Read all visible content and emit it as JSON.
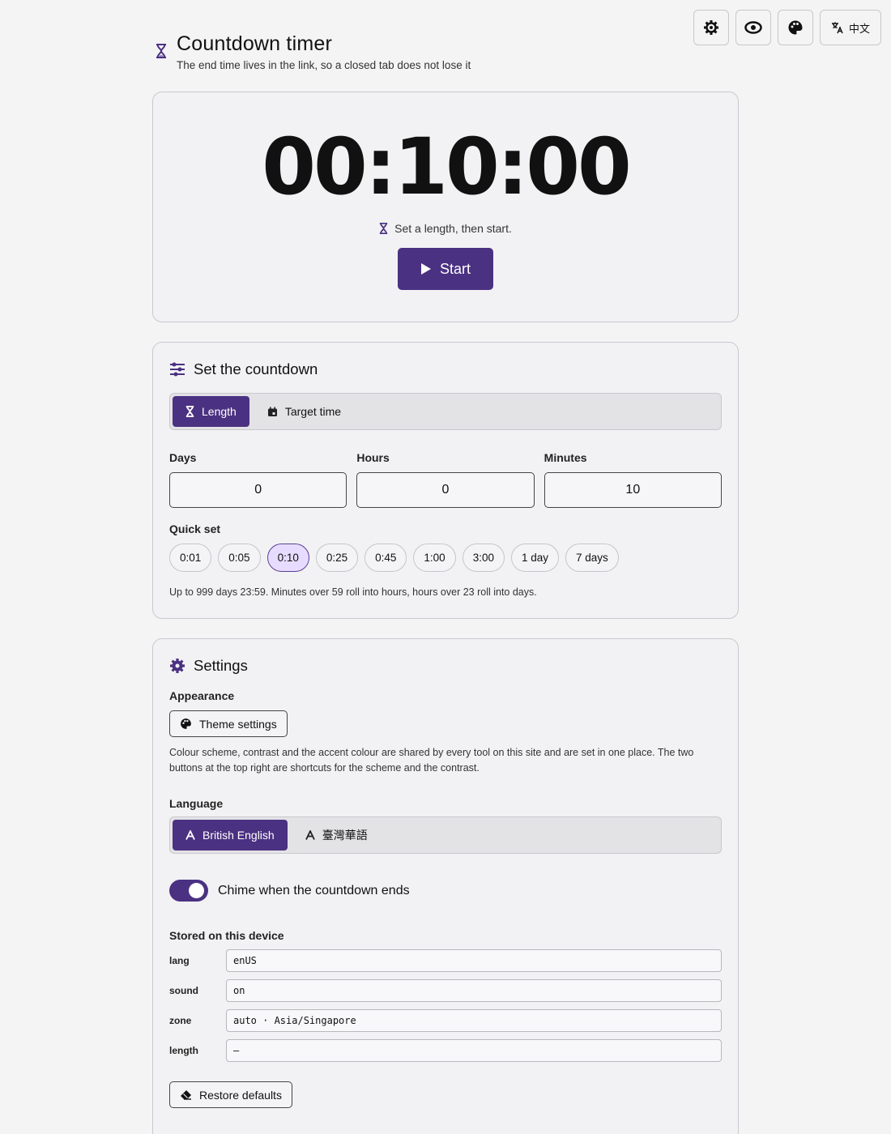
{
  "toolbar": {
    "scheme_icon": "gear-icon",
    "contrast_icon": "eye-icon",
    "theme_icon": "palette-icon",
    "language_label": "中文"
  },
  "header": {
    "title": "Countdown timer",
    "subtitle": "The end time lives in the link, so a closed tab does not lose it"
  },
  "timer": {
    "display": "00:10:00",
    "status": "Set a length, then start.",
    "start_label": "Start"
  },
  "set_countdown": {
    "title": "Set the countdown",
    "modes": [
      "Length",
      "Target time"
    ],
    "active_mode": "Length",
    "fields": [
      {
        "label": "Days",
        "value": "0"
      },
      {
        "label": "Hours",
        "value": "0"
      },
      {
        "label": "Minutes",
        "value": "10"
      }
    ],
    "quick_set_label": "Quick set",
    "quick_set": [
      "0:01",
      "0:05",
      "0:10",
      "0:25",
      "0:45",
      "1:00",
      "3:00",
      "1 day",
      "7 days"
    ],
    "quick_set_active": "0:10",
    "hint": "Up to 999 days 23:59. Minutes over 59 roll into hours, hours over 23 roll into days."
  },
  "settings": {
    "title": "Settings",
    "appearance_label": "Appearance",
    "theme_button": "Theme settings",
    "appearance_note": "Colour scheme, contrast and the accent colour are shared by every tool on this site and are set in one place. The two buttons at the top right are shortcuts for the scheme and the contrast.",
    "language_label": "Language",
    "languages": [
      "British English",
      "臺灣華語"
    ],
    "active_language": "British English",
    "chime_label": "Chime when the countdown ends",
    "chime_on": true,
    "stored_label": "Stored on this device",
    "stored": [
      {
        "key": "lang",
        "value": "enUS"
      },
      {
        "key": "sound",
        "value": "on"
      },
      {
        "key": "zone",
        "value": "auto · Asia/Singapore"
      },
      {
        "key": "length",
        "value": "—"
      }
    ],
    "restore_label": "Restore defaults"
  },
  "colors": {
    "accent": "#4b3182",
    "chip_active_bg": "#e7dcff",
    "background": "#f4f4f5"
  }
}
